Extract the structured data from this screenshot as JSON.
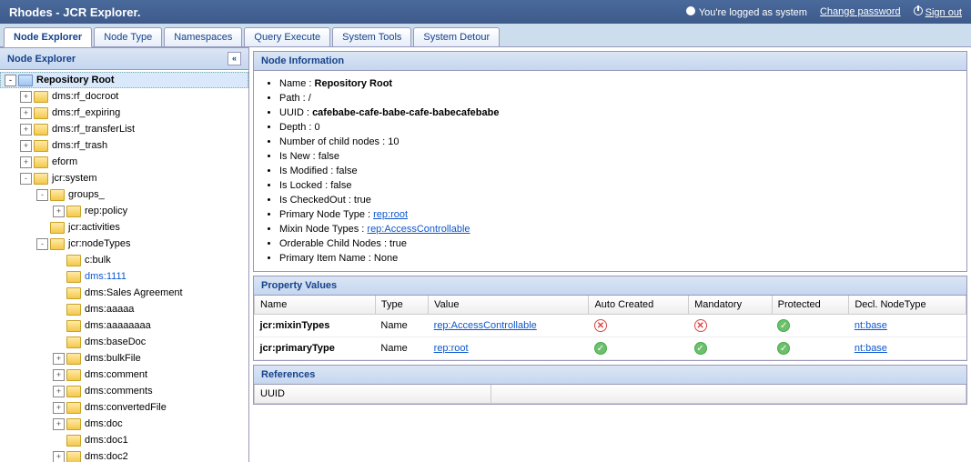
{
  "header": {
    "title": "Rhodes - JCR Explorer.",
    "logged_as": "You're logged as system",
    "change_pw": "Change password",
    "sign_out": "Sign out"
  },
  "tabs": [
    "Node Explorer",
    "Node Type",
    "Namespaces",
    "Query Execute",
    "System Tools",
    "System Detour"
  ],
  "active_tab": 0,
  "left_panel_title": "Node Explorer",
  "tree": [
    {
      "d": 0,
      "t": "-",
      "root": true,
      "l": "Repository Root",
      "sel": true
    },
    {
      "d": 1,
      "t": "+",
      "l": "dms:rf_docroot"
    },
    {
      "d": 1,
      "t": "+",
      "l": "dms:rf_expiring"
    },
    {
      "d": 1,
      "t": "+",
      "l": "dms:rf_transferList"
    },
    {
      "d": 1,
      "t": "+",
      "l": "dms:rf_trash"
    },
    {
      "d": 1,
      "t": "+",
      "l": "eform"
    },
    {
      "d": 1,
      "t": "-",
      "l": "jcr:system"
    },
    {
      "d": 2,
      "t": "-",
      "l": "groups_"
    },
    {
      "d": 3,
      "t": "+",
      "l": "rep:policy"
    },
    {
      "d": 2,
      "t": " ",
      "l": "jcr:activities"
    },
    {
      "d": 2,
      "t": "-",
      "l": "jcr:nodeTypes"
    },
    {
      "d": 3,
      "t": " ",
      "l": "c:bulk"
    },
    {
      "d": 3,
      "t": " ",
      "l": "dms:1111",
      "link": true
    },
    {
      "d": 3,
      "t": " ",
      "l": "dms:Sales Agreement"
    },
    {
      "d": 3,
      "t": " ",
      "l": "dms:aaaaa"
    },
    {
      "d": 3,
      "t": " ",
      "l": "dms:aaaaaaaa"
    },
    {
      "d": 3,
      "t": " ",
      "l": "dms:baseDoc"
    },
    {
      "d": 3,
      "t": "+",
      "l": "dms:bulkFile"
    },
    {
      "d": 3,
      "t": "+",
      "l": "dms:comment"
    },
    {
      "d": 3,
      "t": "+",
      "l": "dms:comments"
    },
    {
      "d": 3,
      "t": "+",
      "l": "dms:convertedFile"
    },
    {
      "d": 3,
      "t": "+",
      "l": "dms:doc"
    },
    {
      "d": 3,
      "t": " ",
      "l": "dms:doc1"
    },
    {
      "d": 3,
      "t": "+",
      "l": "dms:doc2"
    }
  ],
  "node_info": {
    "title": "Node Information",
    "name_label": "Name : ",
    "name_value": "Repository Root",
    "path": "Path : /",
    "uuid_label": "UUID : ",
    "uuid_value": "cafebabe-cafe-babe-cafe-babecafebabe",
    "depth": "Depth : 0",
    "children": "Number of child nodes : 10",
    "is_new": "Is New : false",
    "is_modified": "Is Modified : false",
    "is_locked": "Is Locked : false",
    "is_checkedout": "Is CheckedOut : true",
    "primary_type_label": "Primary Node Type : ",
    "primary_type_link": "rep:root",
    "mixin_label": "Mixin Node Types : ",
    "mixin_link": "rep:AccessControllable",
    "orderable": "Orderable Child Nodes : true",
    "primary_item": "Primary Item Name : None"
  },
  "props": {
    "title": "Property Values",
    "cols": [
      "Name",
      "Type",
      "Value",
      "Auto Created",
      "Mandatory",
      "Protected",
      "Decl. NodeType"
    ],
    "rows": [
      {
        "name": "jcr:mixinTypes",
        "type": "Name",
        "value": "rep:AccessControllable",
        "auto": false,
        "mand": false,
        "prot": true,
        "decl": "nt:base"
      },
      {
        "name": "jcr:primaryType",
        "type": "Name",
        "value": "rep:root",
        "auto": true,
        "mand": true,
        "prot": true,
        "decl": "nt:base"
      }
    ]
  },
  "refs": {
    "title": "References",
    "col": "UUID"
  }
}
